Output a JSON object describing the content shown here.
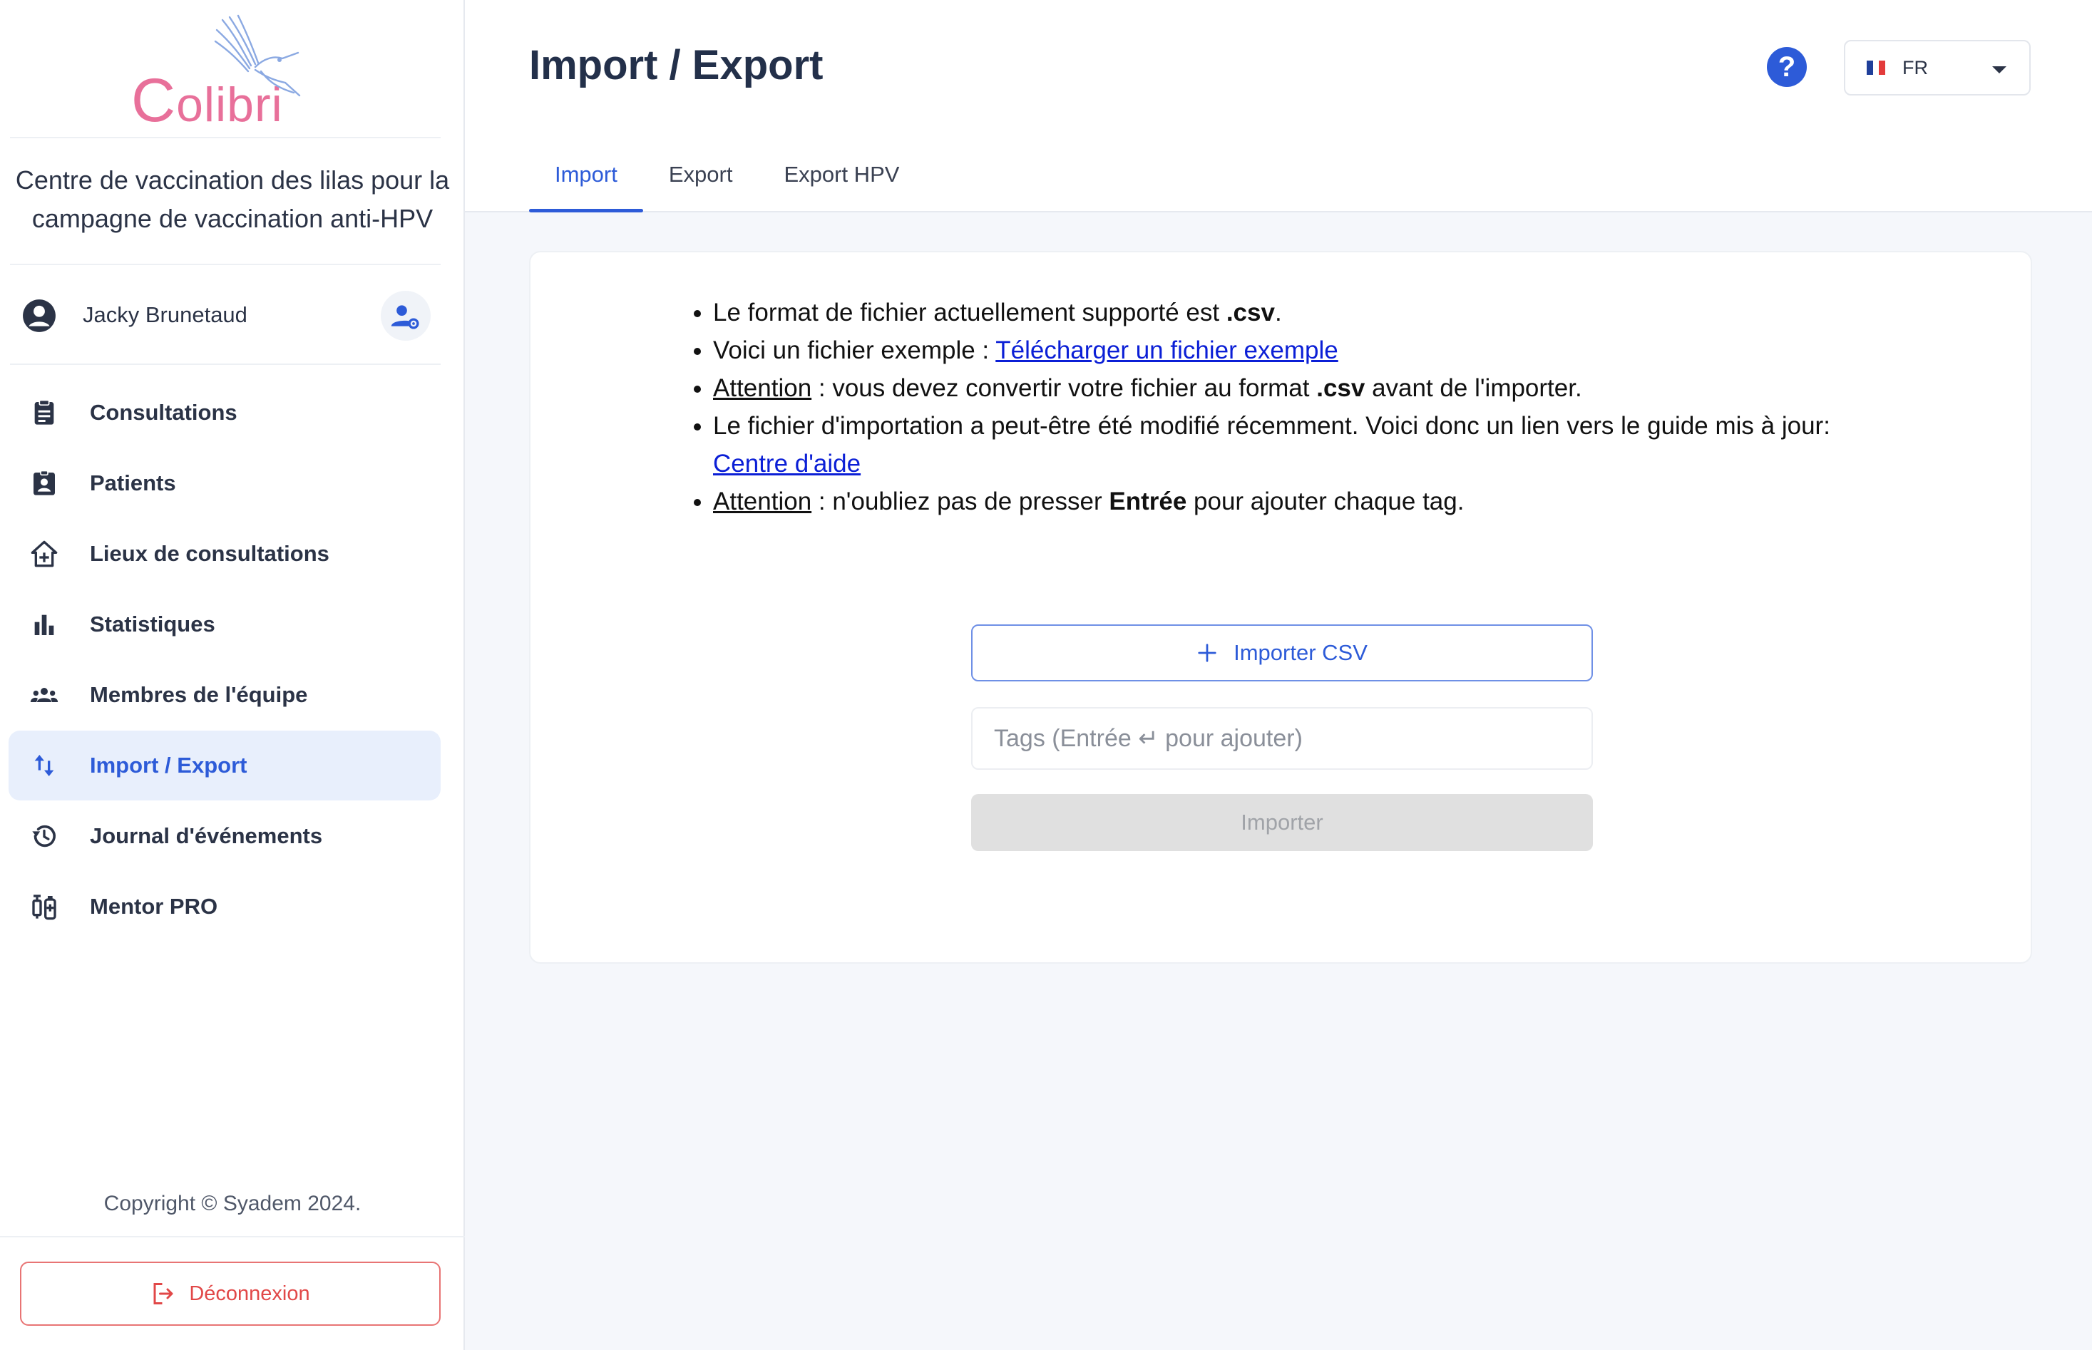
{
  "logo": {
    "first_letter": "C",
    "rest": "olibri"
  },
  "sidebar": {
    "org_name": "Centre de vaccination des lilas pour la campagne de vaccination anti-HPV",
    "user_name": "Jacky Brunetaud",
    "items": [
      {
        "label": "Consultations",
        "icon": "clipboard-icon"
      },
      {
        "label": "Patients",
        "icon": "patient-badge-icon"
      },
      {
        "label": "Lieux de consultations",
        "icon": "house-plus-icon"
      },
      {
        "label": "Statistiques",
        "icon": "bar-chart-icon"
      },
      {
        "label": "Membres de l'équipe",
        "icon": "groups-icon"
      },
      {
        "label": "Import / Export",
        "icon": "import-export-icon",
        "active": true
      },
      {
        "label": "Journal d'événements",
        "icon": "history-icon"
      },
      {
        "label": "Mentor PRO",
        "icon": "vaccine-icon"
      }
    ],
    "copyright": "Copyright © Syadem 2024.",
    "logout_label": "Déconnexion"
  },
  "header": {
    "title": "Import / Export",
    "help_label": "?",
    "language": "FR",
    "tabs": [
      {
        "label": "Import",
        "active": true
      },
      {
        "label": "Export"
      },
      {
        "label": "Export HPV"
      }
    ]
  },
  "import_card": {
    "line1_prefix": "Le format de fichier actuellement supporté est ",
    "line1_bold": ".csv",
    "line1_suffix": ".",
    "line2_prefix": "Voici un fichier exemple : ",
    "line2_link": "Télécharger un fichier exemple",
    "line3_warn": "Attention",
    "line3_prefix": " : vous devez convertir votre fichier au format ",
    "line3_bold": ".csv",
    "line3_suffix": " avant de l'importer.",
    "line4_text": "Le fichier d'importation a peut-être été modifié récemment. Voici donc un lien vers le guide mis à jour:",
    "line4_link": "Centre d'aide",
    "line5_warn": "Attention",
    "line5_prefix": " : n'oubliez pas de presser ",
    "line5_bold": "Entrée",
    "line5_suffix": " pour ajouter chaque tag.",
    "import_csv_label": "Importer CSV",
    "tags_placeholder": "Tags (Entrée ↵ pour ajouter)",
    "import_label": "Importer"
  },
  "colors": {
    "accent": "#2d5bd8",
    "active_bg": "#e8effc",
    "logout_red": "#e14848",
    "logo_pink": "#e8709a",
    "link": "#0b1fd6"
  }
}
